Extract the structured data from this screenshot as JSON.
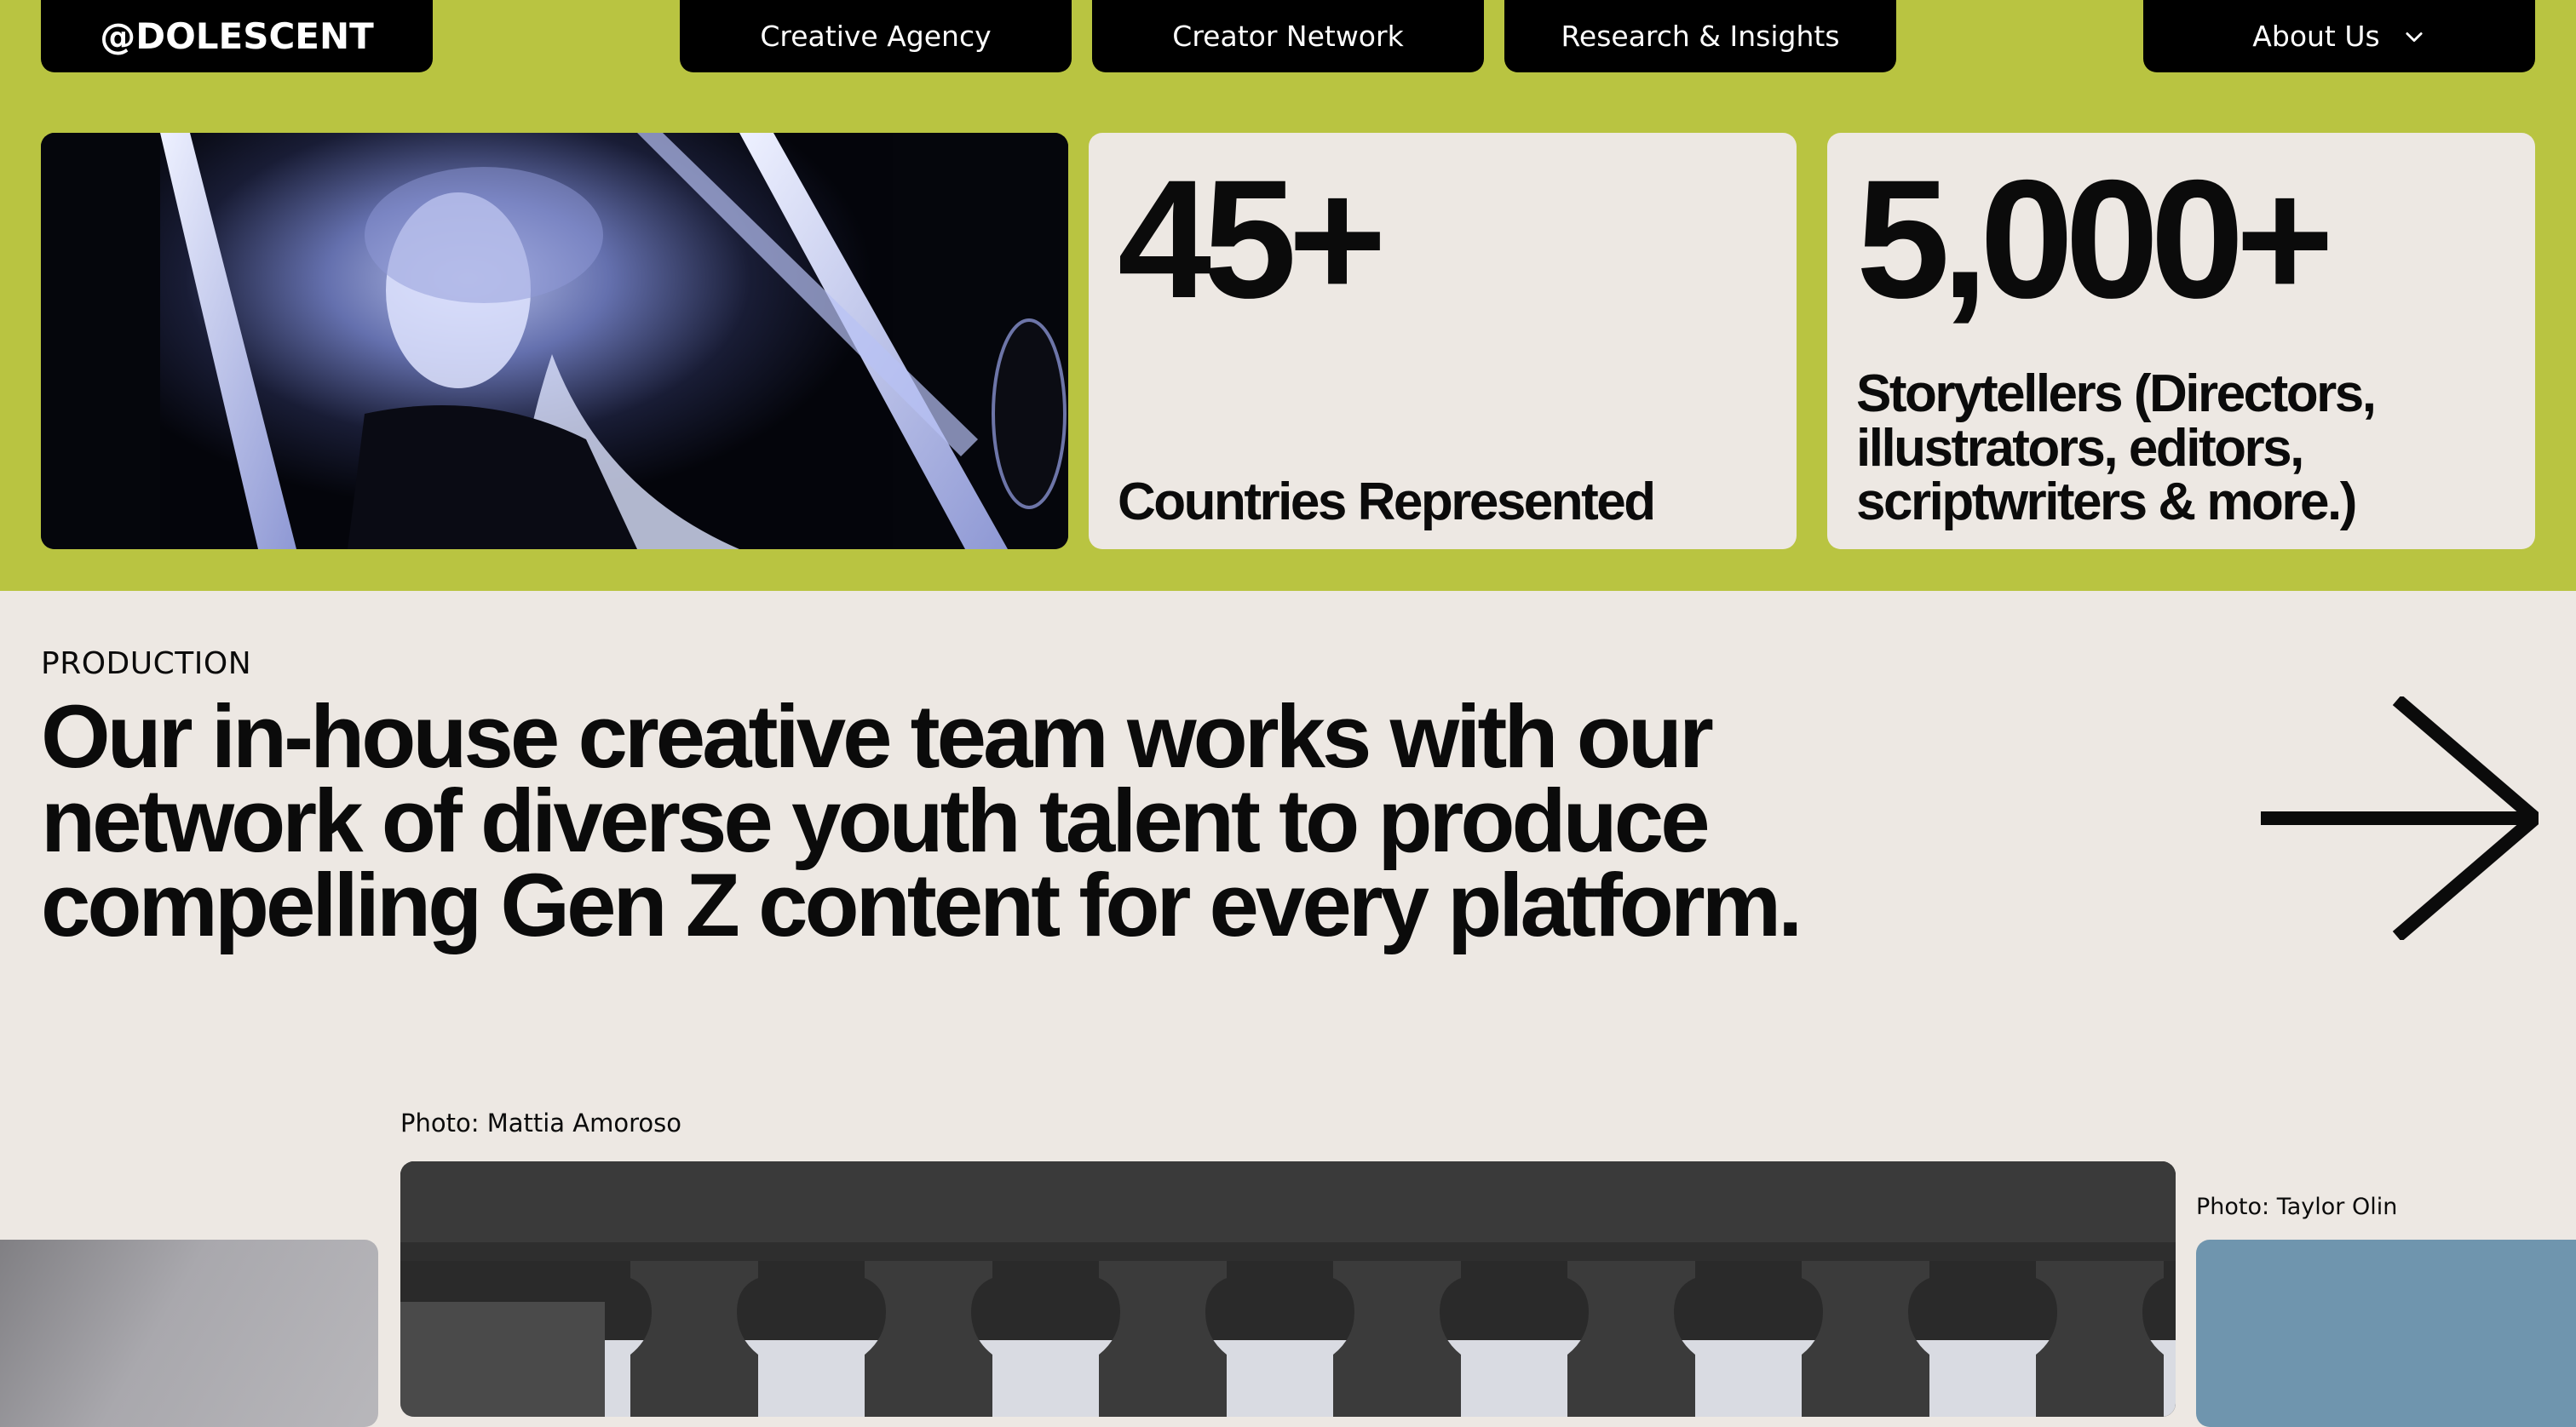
{
  "nav": {
    "logo": "@DOLESCENT",
    "items": [
      {
        "label": "Creative Agency"
      },
      {
        "label": "Creator Network"
      },
      {
        "label": "Research & Insights"
      }
    ],
    "about": {
      "label": "About Us",
      "icon": "chevron-down-icon"
    }
  },
  "colors": {
    "accent": "#b9c441",
    "background": "#ede8e3",
    "nav_bg": "#000000",
    "text": "#0b0b0b"
  },
  "stats": [
    {
      "value": "45+",
      "label": "Countries Represented"
    },
    {
      "value": "5,000+",
      "label": "Storytellers (Directors, illustrators, editors, scriptwriters & more.)"
    }
  ],
  "production": {
    "eyebrow": "PRODUCTION",
    "headline": "Our in-house creative team works with our network of diverse youth talent to produce compelling Gen Z content for every platform.",
    "arrow_icon": "arrow-right-icon"
  },
  "gallery": {
    "captions": [
      "Photo: Mattia Amoroso",
      "Photo: Taylor Olin"
    ]
  }
}
